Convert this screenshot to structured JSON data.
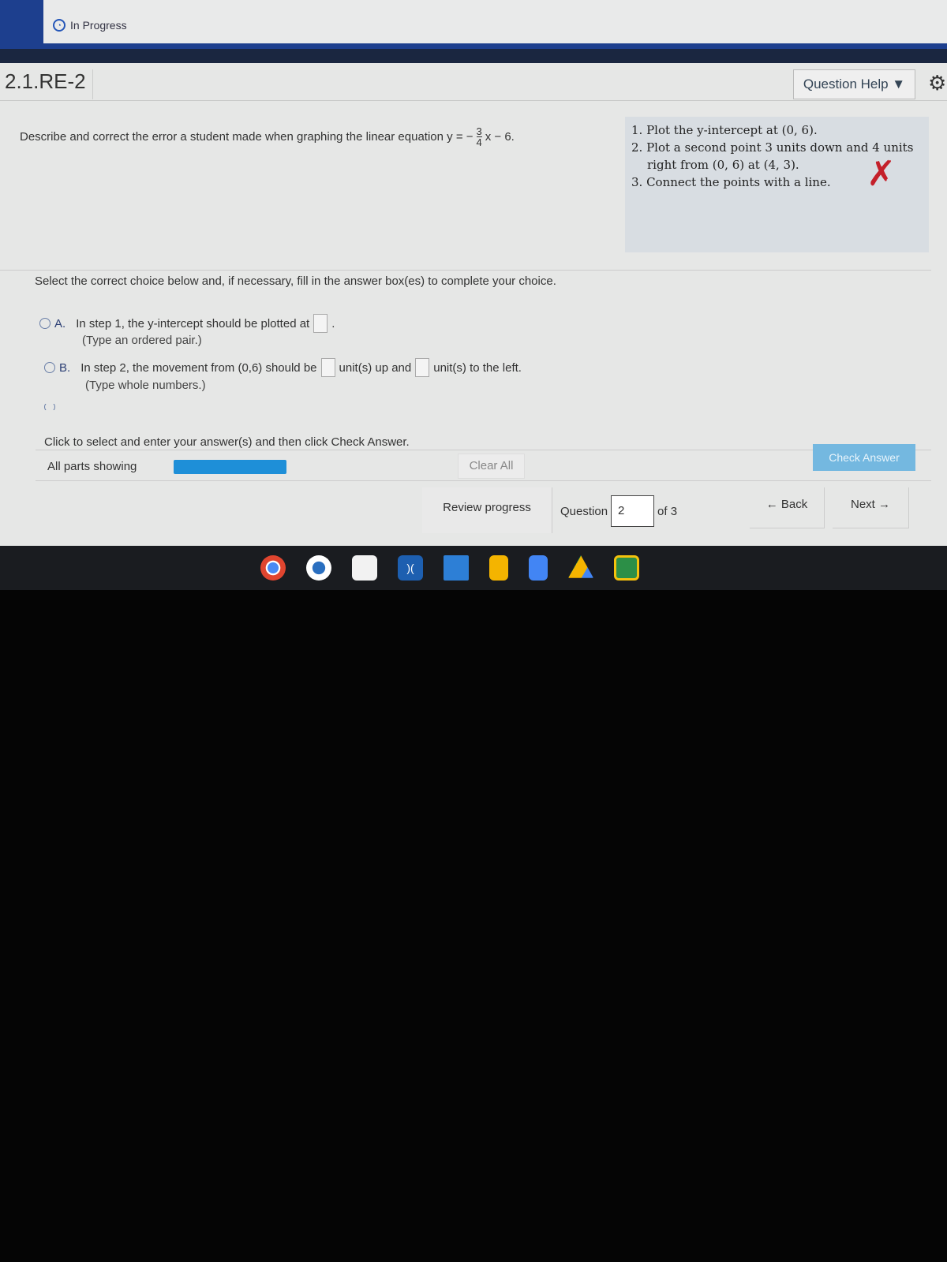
{
  "status": {
    "label": "In Progress"
  },
  "header": {
    "question_id": "2.1.RE-2",
    "question_help": "Question Help ▼"
  },
  "prompt": {
    "text": "Describe and correct the error a student made when graphing the linear equation y = −",
    "frac_num": "3",
    "frac_den": "4",
    "tail": "x − 6."
  },
  "student_work": {
    "steps": [
      "1. Plot the y-intercept at (0, 6).",
      "2. Plot a second point 3 units down and 4 units",
      "right from (0, 6) at (4, 3).",
      "3. Connect the points with a line."
    ],
    "mark": "✗"
  },
  "instructions": "Select the correct choice below and, if necessary, fill in the answer box(es) to complete your choice.",
  "options": [
    {
      "letter": "A.",
      "text": "In step 1, the y-intercept should be plotted at",
      "after": ".",
      "hint": "(Type an ordered pair.)"
    },
    {
      "letter": "B.",
      "text": "In step 2, the movement from (0,6) should be",
      "mid": "unit(s) up and",
      "after": "unit(s) to the left.",
      "hint": "(Type whole numbers.)"
    }
  ],
  "click_instructions": "Click to select and enter your answer(s) and then click Check Answer.",
  "footer": {
    "all_parts": "All parts showing",
    "progress_fraction": 1.0,
    "clear_all": "Clear All",
    "check_answer": "Check Answer"
  },
  "nav": {
    "review": "Review progress",
    "question_label": "Question",
    "question_value": "2",
    "of": "of 3",
    "back": "← Back",
    "next": "Next →"
  },
  "shelf": {
    "apps": [
      "chrome-icon",
      "browser-icon",
      "graph-icon",
      "remote-icon",
      "printer-icon",
      "slides-icon",
      "docs-icon",
      "drive-icon",
      "classroom-icon"
    ]
  },
  "colors": {
    "accent": "#1e8fd8",
    "check_answer": "#74b8e0",
    "mark": "#c4202a"
  }
}
